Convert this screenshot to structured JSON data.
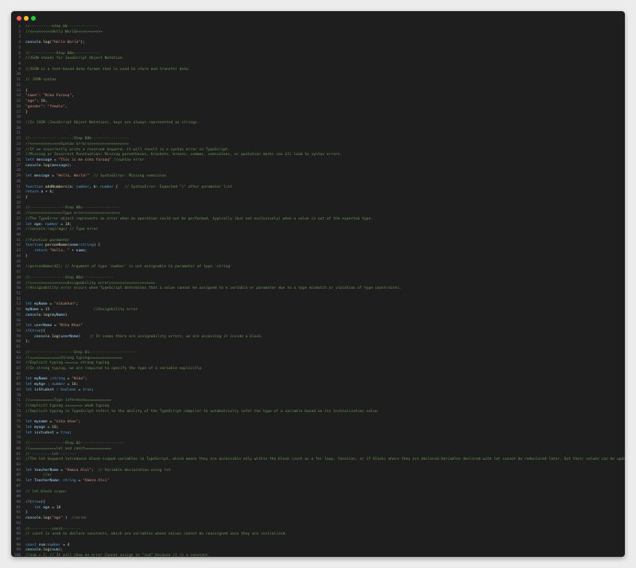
{
  "window": {
    "controls": [
      "close",
      "minimize",
      "zoom"
    ]
  },
  "colors": {
    "comment": "#6a9955",
    "keyword": "#569cd6",
    "string": "#ce9178",
    "variable": "#9cdcfe",
    "function": "#dcdcaa",
    "number": "#b5cea8",
    "plain": "#d4d4d4",
    "background": "#1e1e1e"
  },
  "lines": [
    {
      "n": "1",
      "segs": [
        [
          "c",
          "//----------Step 00--------------"
        ]
      ]
    },
    {
      "n": "2",
      "segs": [
        [
          "c",
          "//<<<<<<<<<<Hello World>>>>>>>>>>>>"
        ]
      ]
    },
    {
      "n": "3",
      "segs": []
    },
    {
      "n": "4",
      "segs": [
        [
          "v",
          "console"
        ],
        [
          "p",
          "."
        ],
        [
          "f",
          "log"
        ],
        [
          "p",
          "("
        ],
        [
          "s",
          "\"Hello World\""
        ],
        [
          "p",
          ");"
        ]
      ]
    },
    {
      "n": "5",
      "segs": []
    },
    {
      "n": "6",
      "segs": [
        [
          "c",
          "//------------Step 00a------------"
        ]
      ]
    },
    {
      "n": "7",
      "segs": [
        [
          "c",
          "//JSON stands for JavaScript Object Notation."
        ]
      ]
    },
    {
      "n": "8",
      "segs": []
    },
    {
      "n": "9",
      "segs": [
        [
          "c",
          "//JSON is a text-based data format that is used to store and transfer data."
        ]
      ]
    },
    {
      "n": "10",
      "segs": []
    },
    {
      "n": "11",
      "segs": [
        [
          "c",
          "// JSON syntax"
        ]
      ]
    },
    {
      "n": "12",
      "segs": []
    },
    {
      "n": "13",
      "segs": [
        [
          "p",
          "{"
        ]
      ]
    },
    {
      "n": "14",
      "segs": [
        [
          "s",
          "\"name\""
        ],
        [
          "p",
          ": "
        ],
        [
          "s",
          "\"Nika Farooq\""
        ],
        [
          "p",
          ","
        ]
      ]
    },
    {
      "n": "15",
      "segs": [
        [
          "s",
          "\"age\""
        ],
        [
          "p",
          ": "
        ],
        [
          "n",
          "18"
        ],
        [
          "p",
          ","
        ]
      ]
    },
    {
      "n": "16",
      "segs": [
        [
          "s",
          "\"gender\""
        ],
        [
          "p",
          ": "
        ],
        [
          "s",
          "\"female\""
        ],
        [
          "p",
          ","
        ]
      ]
    },
    {
      "n": "17",
      "segs": [
        [
          "p",
          "}"
        ]
      ]
    },
    {
      "n": "18",
      "segs": []
    },
    {
      "n": "19",
      "segs": [
        [
          "c",
          "//In JSON (JavaScript Object Notation), keys are always represented as strings."
        ]
      ]
    },
    {
      "n": "20",
      "segs": []
    },
    {
      "n": "21",
      "segs": []
    },
    {
      "n": "22",
      "segs": [
        [
          "c",
          "//--------------------Step 00b-----------------"
        ]
      ]
    },
    {
      "n": "23",
      "segs": [
        [
          "c",
          "//<<<<<<<<<<<<<<Syntax errors>>>>>>>>>>>>>>>>>>"
        ]
      ]
    },
    {
      "n": "24",
      "segs": [
        [
          "c",
          "//If we incorrectly write a reserved keyword, it will result in a syntax error in TypeScript."
        ]
      ]
    },
    {
      "n": "25",
      "segs": [
        [
          "c",
          "//Missing or Incorrect Punctuation: Missing parentheses, brackets, braces, commas, semicolons, or quotation marks can all lead to syntax errors."
        ]
      ]
    },
    {
      "n": "26",
      "segs": [
        [
          "k",
          "lett "
        ],
        [
          "v",
          "message"
        ],
        [
          "p",
          " = "
        ],
        [
          "s",
          "\"This is me nika farooq\""
        ],
        [
          "p",
          " "
        ],
        [
          "c",
          "//syntax error"
        ]
      ]
    },
    {
      "n": "27",
      "segs": [
        [
          "v",
          "console"
        ],
        [
          "p",
          "."
        ],
        [
          "f",
          "log"
        ],
        [
          "p",
          "("
        ],
        [
          "v",
          "message"
        ],
        [
          "p",
          ");"
        ]
      ]
    },
    {
      "n": "28",
      "segs": []
    },
    {
      "n": "29",
      "segs": [
        [
          "k",
          "let "
        ],
        [
          "v",
          "message"
        ],
        [
          "p",
          " = "
        ],
        [
          "s",
          "\"Hello, World!\""
        ],
        [
          "p",
          "  "
        ],
        [
          "c",
          "// SyntaxError: Missing semicolon"
        ]
      ]
    },
    {
      "n": "30",
      "segs": []
    },
    {
      "n": "31",
      "segs": [
        [
          "k",
          "function "
        ],
        [
          "f",
          "addNumbers"
        ],
        [
          "p",
          "("
        ],
        [
          "v",
          "a"
        ],
        [
          "p",
          ": "
        ],
        [
          "k",
          "number"
        ],
        [
          "p",
          ", "
        ],
        [
          "v",
          "b"
        ],
        [
          "p",
          ": "
        ],
        [
          "k",
          "number"
        ],
        [
          "p",
          " {   "
        ],
        [
          "c",
          "// SyntaxError: Expected \")\" after parameter list"
        ]
      ]
    },
    {
      "n": "32",
      "segs": [
        [
          "k",
          "return "
        ],
        [
          "v",
          "a"
        ],
        [
          "p",
          " + "
        ],
        [
          "v",
          "b"
        ],
        [
          "p",
          ";"
        ]
      ]
    },
    {
      "n": "33",
      "segs": [
        [
          "p",
          "}"
        ]
      ]
    },
    {
      "n": "34",
      "segs": []
    },
    {
      "n": "35",
      "segs": [
        [
          "c",
          "//----------------Step 00c-----------------"
        ]
      ]
    },
    {
      "n": "36",
      "segs": [
        [
          "c",
          "//<<<<<<<<<<<<<<<Type error>>>>>>>>>>>>>>>>"
        ]
      ]
    },
    {
      "n": "37",
      "segs": [
        [
          "c",
          "//The TypeError object represents an error when an operation could not be performed, typically (but not exclusively) when a value is not of the expected type."
        ]
      ]
    },
    {
      "n": "38",
      "segs": [
        [
          "k",
          "let "
        ],
        [
          "v",
          "age"
        ],
        [
          "p",
          ": "
        ],
        [
          "k",
          "number"
        ],
        [
          "p",
          " = "
        ],
        [
          "n",
          "18"
        ],
        [
          "p",
          ";"
        ]
      ]
    },
    {
      "n": "39",
      "segs": [
        [
          "c",
          "//console.log(rage) // Type error"
        ]
      ]
    },
    {
      "n": "40",
      "segs": []
    },
    {
      "n": "41",
      "segs": [
        [
          "c",
          "//function parameter"
        ]
      ]
    },
    {
      "n": "42",
      "segs": [
        [
          "k",
          "function "
        ],
        [
          "f",
          "personName"
        ],
        [
          "p",
          "("
        ],
        [
          "v",
          "name"
        ],
        [
          "p",
          ":"
        ],
        [
          "k",
          "string"
        ],
        [
          "p",
          ") {"
        ]
      ]
    },
    {
      "n": "43",
      "segs": [
        [
          "p",
          "    "
        ],
        [
          "k",
          "return "
        ],
        [
          "s",
          "\"Hello, \""
        ],
        [
          "p",
          " + "
        ],
        [
          "v",
          "name"
        ],
        [
          "p",
          ";"
        ]
      ]
    },
    {
      "n": "44",
      "segs": [
        [
          "p",
          "}"
        ]
      ]
    },
    {
      "n": "45",
      "segs": []
    },
    {
      "n": "46",
      "segs": [
        [
          "c",
          "//personName(42); // Argument of type 'number' is not assignable to parameter of type 'string'"
        ]
      ]
    },
    {
      "n": "47",
      "segs": []
    },
    {
      "n": "48",
      "segs": [
        [
          "c",
          "//----------------Step 00d--------------"
        ]
      ]
    },
    {
      "n": "49",
      "segs": [
        [
          "c",
          "//<<<<<<<<<<<<<<<<<Assignability error>>>>>>>>>>>>>>>>>>>>>"
        ]
      ]
    },
    {
      "n": "50",
      "segs": [
        [
          "c",
          "//Assignability error occurs when TypeScript determines that a value cannot be assigned to a variable or parameter due to a type mismatch or violation of type constraints."
        ]
      ]
    },
    {
      "n": "51",
      "segs": []
    },
    {
      "n": "52",
      "segs": []
    },
    {
      "n": "53",
      "segs": [
        [
          "k",
          "let "
        ],
        [
          "v",
          "myName"
        ],
        [
          "p",
          " = "
        ],
        [
          "s",
          "\"nikakhan\""
        ],
        [
          "p",
          ";"
        ]
      ]
    },
    {
      "n": "54",
      "segs": [
        [
          "v",
          "myName"
        ],
        [
          "p",
          " = "
        ],
        [
          "n",
          "15"
        ],
        [
          "p",
          "                    "
        ],
        [
          "c",
          "//Assignbility error"
        ]
      ]
    },
    {
      "n": "55",
      "segs": [
        [
          "v",
          "console"
        ],
        [
          "p",
          "."
        ],
        [
          "f",
          "log"
        ],
        [
          "p",
          "("
        ],
        [
          "v",
          "myName"
        ],
        [
          "p",
          ")"
        ]
      ]
    },
    {
      "n": "56",
      "segs": []
    },
    {
      "n": "57",
      "segs": [
        [
          "k",
          "let "
        ],
        [
          "v",
          "userName"
        ],
        [
          "p",
          " = "
        ],
        [
          "s",
          "\"Nika Khan\""
        ]
      ]
    },
    {
      "n": "58",
      "segs": [
        [
          "k",
          "if"
        ],
        [
          "p",
          "("
        ],
        [
          "k",
          "true"
        ],
        [
          "p",
          "){"
        ]
      ]
    },
    {
      "n": "59",
      "segs": [
        [
          "p",
          "    "
        ],
        [
          "v",
          "console"
        ],
        [
          "p",
          "."
        ],
        [
          "f",
          "log"
        ],
        [
          "p",
          "("
        ],
        [
          "v",
          "userName"
        ],
        [
          "p",
          ")    "
        ],
        [
          "c",
          "// It seems there are assignability errors; we are accessing it inside a block."
        ]
      ]
    },
    {
      "n": "60",
      "segs": [
        [
          "p",
          "};"
        ]
      ]
    },
    {
      "n": "61",
      "segs": []
    },
    {
      "n": "62",
      "segs": [
        [
          "c",
          "//--------------------Step 01----------------------"
        ]
      ]
    },
    {
      "n": "63",
      "segs": [
        [
          "c",
          "//==============Strong typing==============="
        ]
      ]
    },
    {
      "n": "64",
      "segs": [
        [
          "c",
          "//Explicit typing ====== strong typing"
        ]
      ]
    },
    {
      "n": "65",
      "segs": [
        [
          "c",
          "//In strong typing, we are required to specify the type of a variable explicitly."
        ]
      ]
    },
    {
      "n": "66",
      "segs": []
    },
    {
      "n": "67",
      "segs": [
        [
          "k",
          "let "
        ],
        [
          "v",
          "myName"
        ],
        [
          "p",
          " :"
        ],
        [
          "k",
          "string"
        ],
        [
          "p",
          " = "
        ],
        [
          "s",
          "\"Nika\""
        ],
        [
          "p",
          ";"
        ]
      ]
    },
    {
      "n": "68",
      "segs": [
        [
          "k",
          "let "
        ],
        [
          "v",
          "myAge"
        ],
        [
          "p",
          " : "
        ],
        [
          "k",
          "number"
        ],
        [
          "p",
          " = "
        ],
        [
          "n",
          "10"
        ],
        [
          "p",
          ";"
        ]
      ]
    },
    {
      "n": "69",
      "segs": [
        [
          "k",
          "let "
        ],
        [
          "v",
          "isStudent"
        ],
        [
          "p",
          " : "
        ],
        [
          "k",
          "boolean"
        ],
        [
          "p",
          " = "
        ],
        [
          "k",
          "true"
        ],
        [
          "p",
          ";"
        ]
      ]
    },
    {
      "n": "70",
      "segs": []
    },
    {
      "n": "71",
      "segs": [
        [
          "c",
          "//===========Type inference============"
        ]
      ]
    },
    {
      "n": "72",
      "segs": [
        [
          "c",
          "//implicit typing ======== weak typing"
        ]
      ]
    },
    {
      "n": "73",
      "segs": [
        [
          "c",
          "//Implicit typing in TypeScript refers to the ability of the TypeScript compiler to automatically infer the type of a variable based on its initialization value."
        ]
      ]
    },
    {
      "n": "74",
      "segs": []
    },
    {
      "n": "75",
      "segs": [
        [
          "k",
          "let "
        ],
        [
          "v",
          "myname"
        ],
        [
          "p",
          " = "
        ],
        [
          "s",
          "\"nika khan\""
        ],
        [
          "p",
          ";"
        ]
      ]
    },
    {
      "n": "76",
      "segs": [
        [
          "k",
          "let "
        ],
        [
          "v",
          "myage"
        ],
        [
          "p",
          " = "
        ],
        [
          "n",
          "10"
        ],
        [
          "p",
          ";"
        ]
      ]
    },
    {
      "n": "77",
      "segs": [
        [
          "k",
          "let "
        ],
        [
          "v",
          "isstudent"
        ],
        [
          "p",
          " = "
        ],
        [
          "k",
          "true"
        ],
        [
          "p",
          ";"
        ]
      ]
    },
    {
      "n": "78",
      "segs": []
    },
    {
      "n": "79",
      "segs": [
        [
          "c",
          "//----------------Step 02--------------------"
        ]
      ]
    },
    {
      "n": "80",
      "segs": [
        [
          "c",
          "//============let and const============"
        ]
      ]
    },
    {
      "n": "81",
      "segs": [
        [
          "c",
          "// ---------let--------"
        ]
      ]
    },
    {
      "n": "82",
      "segs": [
        [
          "c",
          "//The let keyword introduces block-scoped variables in TypeScript, which means they are accessible only within the block (such as a for loop, function, or if block) where they are declared.Variables declared with let cannot be redeclared later, but their values can be updated."
        ]
      ]
    },
    {
      "n": "83",
      "segs": []
    },
    {
      "n": "84",
      "segs": [
        [
          "k",
          "let "
        ],
        [
          "v",
          "teacherName"
        ],
        [
          "p",
          " = "
        ],
        [
          "s",
          "\"Hamza Alvi\""
        ],
        [
          "p",
          ";  "
        ],
        [
          "c",
          "// Variable declaration using let"
        ]
      ]
    },
    {
      "n": "85",
      "segs": [
        [
          "p",
          "        "
        ],
        [
          "c",
          "//or"
        ]
      ]
    },
    {
      "n": "86",
      "segs": [
        [
          "k",
          "let "
        ],
        [
          "v",
          "TeacherName"
        ],
        [
          "p",
          ": "
        ],
        [
          "k",
          "string"
        ],
        [
          "p",
          " = "
        ],
        [
          "s",
          "\"Hamza Alvi\""
        ]
      ]
    },
    {
      "n": "87",
      "segs": []
    },
    {
      "n": "88",
      "segs": [
        [
          "c",
          "// let block scope:"
        ]
      ]
    },
    {
      "n": "89",
      "segs": []
    },
    {
      "n": "90",
      "segs": [
        [
          "k",
          "if"
        ],
        [
          "p",
          "("
        ],
        [
          "k",
          "true"
        ],
        [
          "p",
          "){"
        ]
      ]
    },
    {
      "n": "91",
      "segs": [
        [
          "p",
          "    "
        ],
        [
          "k",
          "let "
        ],
        [
          "v",
          "age"
        ],
        [
          "p",
          " = "
        ],
        [
          "n",
          "18"
        ]
      ]
    },
    {
      "n": "92",
      "segs": [
        [
          "p",
          "}"
        ]
      ]
    },
    {
      "n": "93",
      "segs": [
        [
          "v",
          "console"
        ],
        [
          "p",
          "."
        ],
        [
          "f",
          "log"
        ],
        [
          "p",
          "("
        ],
        [
          "s",
          "\"age\""
        ],
        [
          "p",
          " )  "
        ],
        [
          "c",
          "//error"
        ]
      ]
    },
    {
      "n": "94",
      "segs": []
    },
    {
      "n": "95",
      "segs": [
        [
          "c",
          "//----------const--------"
        ]
      ]
    },
    {
      "n": "96",
      "segs": [
        [
          "c",
          "// const is used to declare constants, which are variables whose values cannot be reassigned once they are initialized."
        ]
      ]
    },
    {
      "n": "97",
      "segs": []
    },
    {
      "n": "98",
      "segs": [
        [
          "k",
          "const "
        ],
        [
          "v",
          "num"
        ],
        [
          "p",
          ":"
        ],
        [
          "k",
          "number"
        ],
        [
          "p",
          " = "
        ],
        [
          "n",
          "4"
        ]
      ]
    },
    {
      "n": "99",
      "segs": [
        [
          "v",
          "console"
        ],
        [
          "p",
          "."
        ],
        [
          "f",
          "log"
        ],
        [
          "p",
          "("
        ],
        [
          "v",
          "num"
        ],
        [
          "p",
          ");"
        ]
      ]
    },
    {
      "n": "100",
      "segs": [
        [
          "c",
          "//num = 2; // It will show an error Cannot assign to \"num\" because it is a constant."
        ]
      ]
    }
  ]
}
